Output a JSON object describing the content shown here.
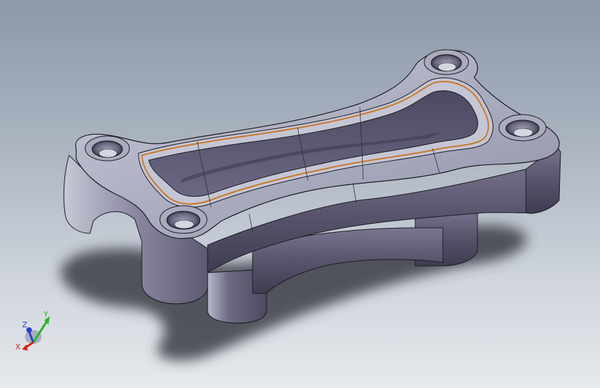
{
  "viewport": {
    "background_top": "#8d98a8",
    "background_bottom": "#e6e9ed"
  },
  "model": {
    "body_color": "#5a5670",
    "edge_color": "#1a1a22",
    "highlight_color": "#c9cbd8",
    "groove_accent_color": "#c9782a"
  },
  "triad": {
    "x_label": "X",
    "y_label": "Y",
    "z_label": "Z",
    "x_color": "#d81e1e",
    "y_color": "#27b427",
    "z_color": "#2a3fd1"
  }
}
